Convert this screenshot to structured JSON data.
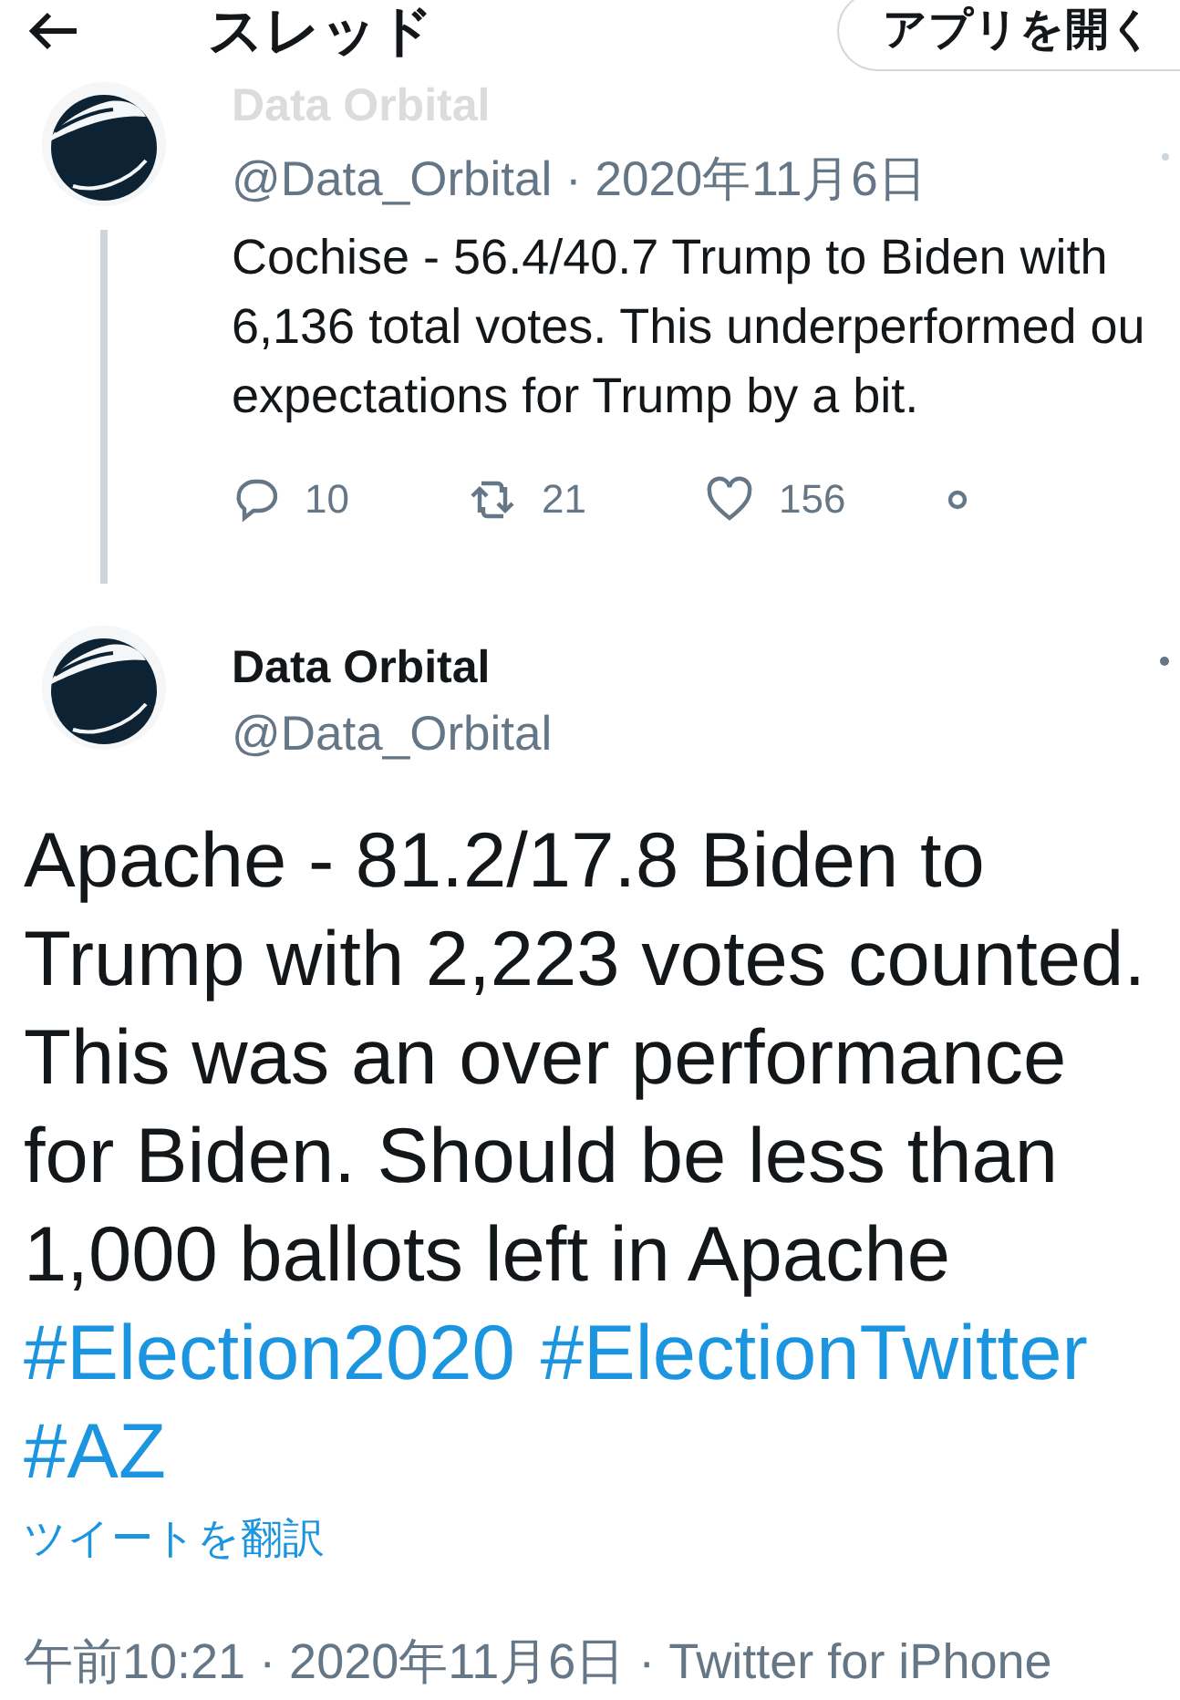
{
  "header": {
    "title": "スレッド",
    "open_app_button": "アプリを開く"
  },
  "parent_tweet": {
    "name": "Data Orbital",
    "name_faded": true,
    "handle": "@Data_Orbital",
    "date": "· 2020年11月6日",
    "text_lines": [
      "Cochise - 56.4/40.7 Trump to Biden with",
      "6,136 total votes. This underperformed ou",
      "expectations for Trump by a bit."
    ],
    "actions": [
      {
        "kind": "reply",
        "count": "10"
      },
      {
        "kind": "retweet",
        "count": "21"
      },
      {
        "kind": "like",
        "count": "156"
      },
      {
        "kind": "share"
      }
    ]
  },
  "main_tweet": {
    "name": "Data Orbital",
    "handle": "@Data_Orbital",
    "text_lines": [
      "Apache - 81.2/17.8 Biden to",
      "Trump with 2,223 votes counted.",
      "This was an over performance",
      "for Biden. Should be less than",
      "1,000 ballots left in Apache"
    ],
    "hashtags": [
      "#Election2020",
      "#ElectionTwitter",
      "#AZ"
    ],
    "translate": "ツイートを翻訳",
    "timestamp": "午前10:21 · 2020年11月6日 · Twitter for iPhone"
  }
}
